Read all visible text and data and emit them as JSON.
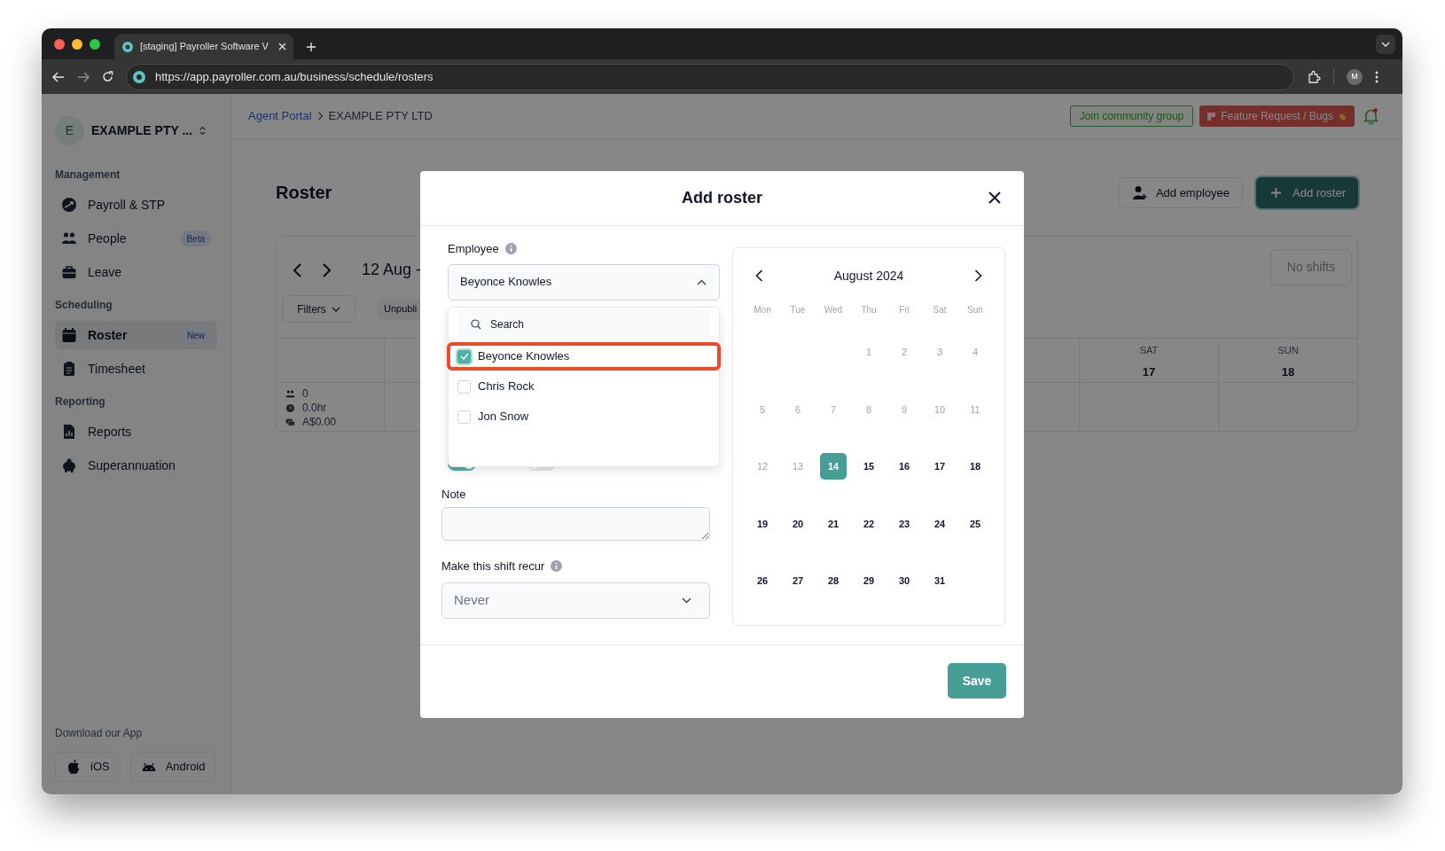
{
  "browser": {
    "tab_title": "[staging] Payroller Software V",
    "url": "https://app.payroller.com.au/business/schedule/rosters",
    "profile_initial": "M"
  },
  "sidebar": {
    "company_initial": "E",
    "company_name": "EXAMPLE PTY ...",
    "sections": [
      {
        "title": "Management",
        "items": [
          {
            "label": "Payroll & STP",
            "selected": false
          },
          {
            "label": "People",
            "badge": "Beta",
            "selected": false
          },
          {
            "label": "Leave",
            "selected": false
          }
        ]
      },
      {
        "title": "Scheduling",
        "items": [
          {
            "label": "Roster",
            "badge": "New",
            "selected": true
          },
          {
            "label": "Timesheet",
            "selected": false
          }
        ]
      },
      {
        "title": "Reporting",
        "items": [
          {
            "label": "Reports",
            "selected": false
          },
          {
            "label": "Superannuation",
            "selected": false
          }
        ]
      }
    ],
    "download": {
      "title": "Download our App",
      "buttons": [
        {
          "label": "iOS"
        },
        {
          "label": "Android"
        }
      ]
    }
  },
  "header": {
    "breadcrumb": [
      {
        "label": "Agent Portal",
        "kind": "link"
      },
      {
        "label": "EXAMPLE PTY LTD",
        "kind": "current"
      }
    ],
    "community_button": "Join community group",
    "feature_button": "Feature Request / Bugs"
  },
  "page": {
    "title": "Roster",
    "actions": [
      {
        "label": "Add employee",
        "kind": "secondary"
      },
      {
        "label": "Add roster",
        "kind": "primary"
      }
    ],
    "week_label": "12 Aug -",
    "filters": "Filters",
    "status_chip": "Unpubli",
    "no_shifts": "No shifts",
    "days": [
      {
        "label": "SAT",
        "date": "17"
      },
      {
        "label": "SUN",
        "date": "18"
      }
    ],
    "stats": [
      {
        "value": "0"
      },
      {
        "value": "0.0hr"
      },
      {
        "value": "A$0.00"
      }
    ]
  },
  "modal": {
    "title": "Add roster",
    "employee": {
      "label": "Employee",
      "value": "Beyonce Knowles",
      "expanded": true,
      "search_placeholder": "Search",
      "options": [
        {
          "name": "Beyonce Knowles",
          "checked": true,
          "highlighted": true
        },
        {
          "name": "Chris Rock",
          "checked": false,
          "highlighted": false
        },
        {
          "name": "Jon Snow",
          "checked": false,
          "highlighted": false
        }
      ]
    },
    "breaks": [
      {
        "on": true
      },
      {
        "on": false
      }
    ],
    "note": {
      "label": "Note"
    },
    "recur": {
      "label": "Make this shift recur",
      "value": "Never"
    },
    "calendar": {
      "month": "August 2024",
      "weekdays": [
        "Mon",
        "Tue",
        "Wed",
        "Thu",
        "Fri",
        "Sat",
        "Sun"
      ],
      "weeks": [
        [
          {
            "day": "1",
            "disabled": true,
            "selected": false
          },
          {
            "day": "2",
            "disabled": true,
            "selected": false
          },
          {
            "day": "3",
            "disabled": true,
            "selected": false
          },
          {
            "day": "4",
            "disabled": true,
            "selected": false
          }
        ],
        [
          {
            "day": "5",
            "disabled": true,
            "selected": false
          },
          {
            "day": "6",
            "disabled": true,
            "selected": false
          },
          {
            "day": "7",
            "disabled": true,
            "selected": false
          },
          {
            "day": "8",
            "disabled": true,
            "selected": false
          },
          {
            "day": "9",
            "disabled": true,
            "selected": false
          },
          {
            "day": "10",
            "disabled": true,
            "selected": false
          },
          {
            "day": "11",
            "disabled": true,
            "selected": false
          }
        ],
        [
          {
            "day": "12",
            "disabled": true,
            "selected": false
          },
          {
            "day": "13",
            "disabled": true,
            "selected": false
          },
          {
            "day": "14",
            "disabled": false,
            "selected": true
          },
          {
            "day": "15",
            "disabled": false,
            "selected": false
          },
          {
            "day": "16",
            "disabled": false,
            "selected": false
          },
          {
            "day": "17",
            "disabled": false,
            "selected": false
          },
          {
            "day": "18",
            "disabled": false,
            "selected": false
          }
        ],
        [
          {
            "day": "19",
            "disabled": false,
            "selected": false
          },
          {
            "day": "20",
            "disabled": false,
            "selected": false
          },
          {
            "day": "21",
            "disabled": false,
            "selected": false
          },
          {
            "day": "22",
            "disabled": false,
            "selected": false
          },
          {
            "day": "23",
            "disabled": false,
            "selected": false
          },
          {
            "day": "24",
            "disabled": false,
            "selected": false
          },
          {
            "day": "25",
            "disabled": false,
            "selected": false
          }
        ],
        [
          {
            "day": "26",
            "disabled": false,
            "selected": false
          },
          {
            "day": "27",
            "disabled": false,
            "selected": false
          },
          {
            "day": "28",
            "disabled": false,
            "selected": false
          },
          {
            "day": "29",
            "disabled": false,
            "selected": false
          },
          {
            "day": "30",
            "disabled": false,
            "selected": false
          },
          {
            "day": "31",
            "disabled": false,
            "selected": false
          }
        ]
      ]
    },
    "save": "Save"
  }
}
